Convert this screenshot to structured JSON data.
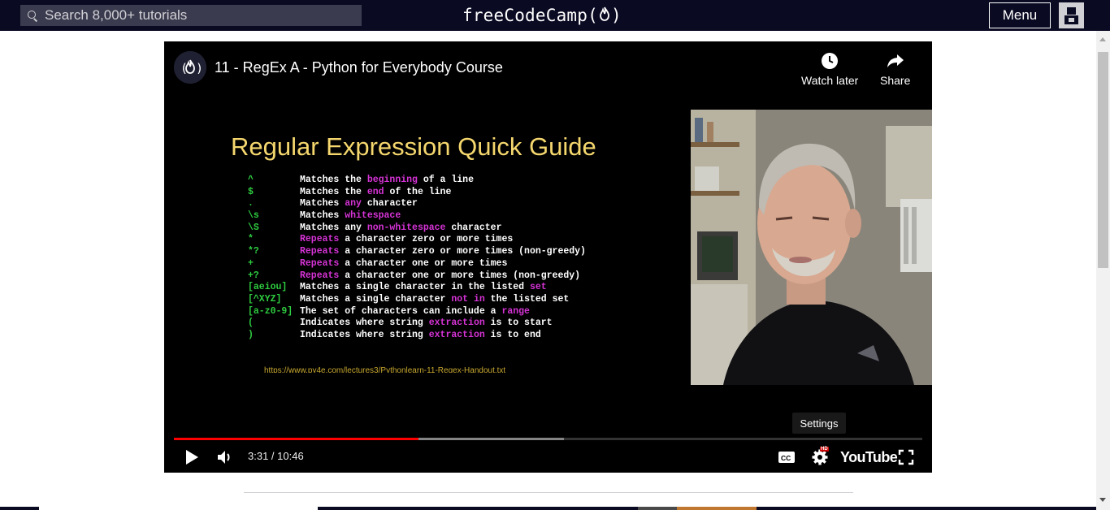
{
  "navbar": {
    "search_placeholder": "Search 8,000+ tutorials",
    "logo_text_before": "freeCodeCamp(",
    "logo_flame": "🔥",
    "logo_text_after": ")",
    "menu_label": "Menu"
  },
  "player": {
    "channel_icon_text": "(🔥)",
    "title": "11 - RegEx A - Python for Everybody Course",
    "watch_later_label": "Watch later",
    "share_label": "Share",
    "tooltip": "Settings",
    "time": "3:31 / 10:46",
    "played_fraction": 0.327,
    "buffered_fraction": 0.521,
    "youtube_label": "YouTube",
    "hd_badge": "HD",
    "progress_color": "#ff0000"
  },
  "slide": {
    "title": "Regular Expression Quick Guide",
    "rows": [
      {
        "symbol": "^",
        "pre": "Matches the ",
        "hl": "beginning",
        "post": " of a line"
      },
      {
        "symbol": "$",
        "pre": "Matches the ",
        "hl": "end",
        "post": " of the line"
      },
      {
        "symbol": ".",
        "pre": "Matches ",
        "hl": "any",
        "post": " character"
      },
      {
        "symbol": "\\s",
        "pre": "Matches ",
        "hl": "whitespace",
        "post": ""
      },
      {
        "symbol": "\\S",
        "pre": "Matches any ",
        "hl": "non-whitespace",
        "post": " character"
      },
      {
        "symbol": "*",
        "pre": "",
        "hl": "Repeats",
        "post": " a character zero or more times"
      },
      {
        "symbol": "*?",
        "pre": "",
        "hl": "Repeats",
        "post": " a character zero or more times (non-greedy)"
      },
      {
        "symbol": "+",
        "pre": "",
        "hl": "Repeats",
        "post": " a character one or more times"
      },
      {
        "symbol": "+?",
        "pre": "",
        "hl": "Repeats",
        "post": " a character one or more times (non-greedy)"
      },
      {
        "symbol": "[aeiou]",
        "pre": "Matches a single character in the listed ",
        "hl": "set",
        "post": ""
      },
      {
        "symbol": "[^XYZ]",
        "pre": "Matches a single character ",
        "hl": "not in",
        "post": " the listed set"
      },
      {
        "symbol": "[a-z0-9]",
        "pre": "The set of characters can include a ",
        "hl": "range",
        "post": ""
      },
      {
        "symbol": "(",
        "pre": "Indicates where string ",
        "hl": "extraction",
        "post": " is to start"
      },
      {
        "symbol": ")",
        "pre": "Indicates where string ",
        "hl": "extraction",
        "post": " is to end"
      }
    ],
    "url": "https://www.py4e.com/lectures3/Pythonlearn-11-Regex-Handout.txt",
    "symbol_color": "#2ecc40",
    "highlight_color": "#d633d6",
    "title_color": "#f5d76e"
  },
  "colors": {
    "nav_bg": "#0a0a23",
    "search_bg": "#3b3b4f"
  }
}
